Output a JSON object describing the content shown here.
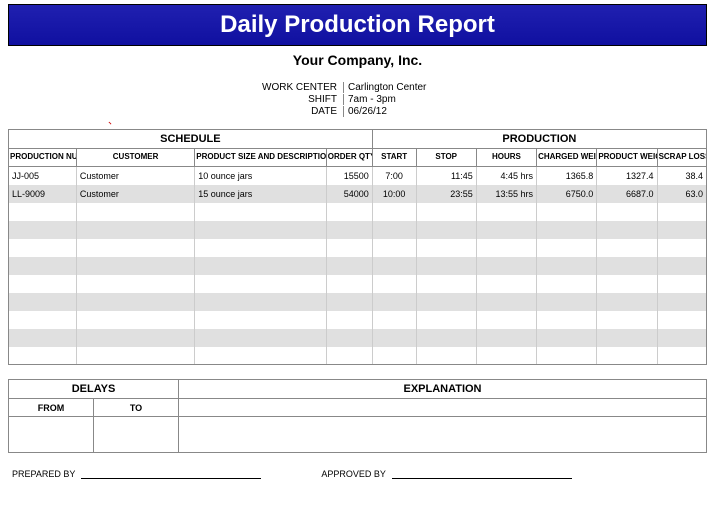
{
  "title": "Daily Production Report",
  "company": "Your Company, Inc.",
  "meta": {
    "work_center_label": "WORK CENTER",
    "work_center": "Carlington Center",
    "shift_label": "SHIFT",
    "shift": "7am - 3pm",
    "date_label": "DATE",
    "date": "06/26/12"
  },
  "sections": {
    "schedule": "SCHEDULE",
    "production": "PRODUCTION"
  },
  "columns": {
    "prod_number": "PRODUCTION NUMBER",
    "customer": "CUSTOMER",
    "product": "PRODUCT SIZE AND DESCRIPTION",
    "order_qty": "ORDER QTY",
    "start": "START",
    "stop": "STOP",
    "hours": "HOURS",
    "charged_weight": "CHARGED WEIGHT",
    "product_weight": "PRODUCT WEIGHT",
    "scrap_loss": "SCRAP LOSS"
  },
  "rows": [
    {
      "prod_number": "JJ-005",
      "customer": "Customer",
      "product": "10 ounce jars",
      "order_qty": "15500",
      "start": "7:00",
      "stop": "11:45",
      "hours": "4:45 hrs",
      "charged_weight": "1365.8",
      "product_weight": "1327.4",
      "scrap_loss": "38.4"
    },
    {
      "prod_number": "LL-9009",
      "customer": "Customer",
      "product": "15 ounce jars",
      "order_qty": "54000",
      "start": "10:00",
      "stop": "23:55",
      "hours": "13:55 hrs",
      "charged_weight": "6750.0",
      "product_weight": "6687.0",
      "scrap_loss": "63.0"
    },
    {
      "prod_number": "",
      "customer": "",
      "product": "",
      "order_qty": "",
      "start": "",
      "stop": "",
      "hours": "",
      "charged_weight": "",
      "product_weight": "",
      "scrap_loss": ""
    },
    {
      "prod_number": "",
      "customer": "",
      "product": "",
      "order_qty": "",
      "start": "",
      "stop": "",
      "hours": "",
      "charged_weight": "",
      "product_weight": "",
      "scrap_loss": ""
    },
    {
      "prod_number": "",
      "customer": "",
      "product": "",
      "order_qty": "",
      "start": "",
      "stop": "",
      "hours": "",
      "charged_weight": "",
      "product_weight": "",
      "scrap_loss": ""
    },
    {
      "prod_number": "",
      "customer": "",
      "product": "",
      "order_qty": "",
      "start": "",
      "stop": "",
      "hours": "",
      "charged_weight": "",
      "product_weight": "",
      "scrap_loss": ""
    },
    {
      "prod_number": "",
      "customer": "",
      "product": "",
      "order_qty": "",
      "start": "",
      "stop": "",
      "hours": "",
      "charged_weight": "",
      "product_weight": "",
      "scrap_loss": ""
    },
    {
      "prod_number": "",
      "customer": "",
      "product": "",
      "order_qty": "",
      "start": "",
      "stop": "",
      "hours": "",
      "charged_weight": "",
      "product_weight": "",
      "scrap_loss": ""
    },
    {
      "prod_number": "",
      "customer": "",
      "product": "",
      "order_qty": "",
      "start": "",
      "stop": "",
      "hours": "",
      "charged_weight": "",
      "product_weight": "",
      "scrap_loss": ""
    },
    {
      "prod_number": "",
      "customer": "",
      "product": "",
      "order_qty": "",
      "start": "",
      "stop": "",
      "hours": "",
      "charged_weight": "",
      "product_weight": "",
      "scrap_loss": ""
    },
    {
      "prod_number": "",
      "customer": "",
      "product": "",
      "order_qty": "",
      "start": "",
      "stop": "",
      "hours": "",
      "charged_weight": "",
      "product_weight": "",
      "scrap_loss": ""
    }
  ],
  "delays": {
    "delays_label": "DELAYS",
    "explanation_label": "EXPLANATION",
    "from_label": "FROM",
    "to_label": "TO"
  },
  "signoff": {
    "prepared_by": "PREPARED BY",
    "approved_by": "APPROVED BY"
  }
}
